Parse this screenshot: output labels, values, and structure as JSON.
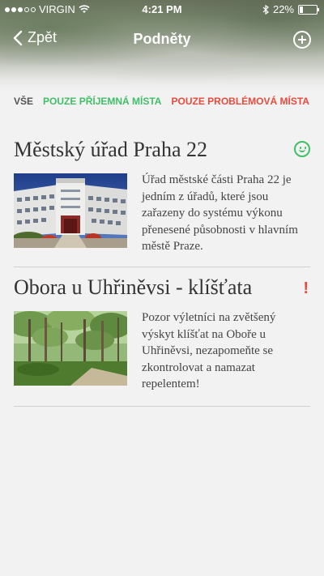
{
  "statusbar": {
    "carrier": "VIRGIN",
    "time": "4:21 PM",
    "battery": "22%",
    "battery_level": 0.22
  },
  "nav": {
    "back_label": "Zpět",
    "title": "Podněty"
  },
  "filters": {
    "all": "VŠE",
    "pleasant": "POUZE PŘÍJEMNÁ MÍSTA",
    "problem": "POUZE PROBLÉMOVÁ MÍSTA"
  },
  "items": [
    {
      "title": "Městský úřad Praha 22",
      "status": "pleasant",
      "status_icon": "smile-icon",
      "description": "Úřad městské části Praha 22 je jedním z úřadů, které jsou zařazeny do systému výkonu přenesené působnosti v hlavním městě Praze."
    },
    {
      "title": "Obora u Uhřiněvsi - klíšťata",
      "status": "problem",
      "status_icon": "exclamation-icon",
      "status_symbol": "!",
      "description": "Pozor výletníci na zvětšený výskyt klíšťat na Oboře u Uhřiněvsi, nezapomeňte se zkontrolovat a namazat repelentem!"
    }
  ],
  "colors": {
    "pleasant": "#3fbf67",
    "problem": "#e84a3c"
  }
}
